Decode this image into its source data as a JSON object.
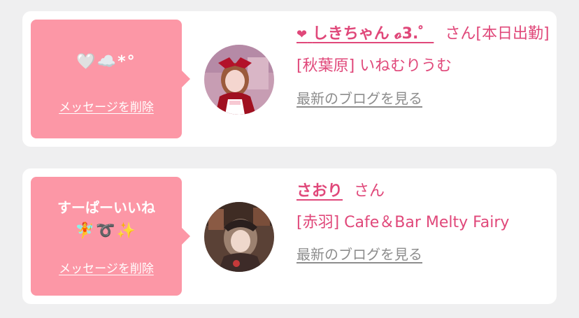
{
  "colors": {
    "page_background": "#efeff0",
    "card_background": "#ffffff",
    "bubble_pink": "#fc97a6",
    "accent_pink": "#e0487a",
    "link_gray": "#8d8d8d"
  },
  "notifications": [
    {
      "message_lines": [
        "🤍☁️*°"
      ],
      "delete_label": "メッセージを削除",
      "heart_icon": "❤",
      "name": "しきちゃん 𝓸3.゜",
      "honorific": "さん",
      "status": "[本日出勤]",
      "shop": "[秋葉原] いねむりうむ",
      "blog_label": "最新のブログを見る",
      "avatar_icon": "profile-photo-red-outfit"
    },
    {
      "message_lines": [
        "すーぱーいいね",
        "🧚➰✨"
      ],
      "delete_label": "メッセージを削除",
      "heart_icon": "",
      "name": "さおり",
      "honorific": "さん",
      "status": "",
      "shop": "[赤羽] Cafe＆Bar Melty Fairy",
      "blog_label": "最新のブログを見る",
      "avatar_icon": "profile-photo-dark-room"
    }
  ]
}
